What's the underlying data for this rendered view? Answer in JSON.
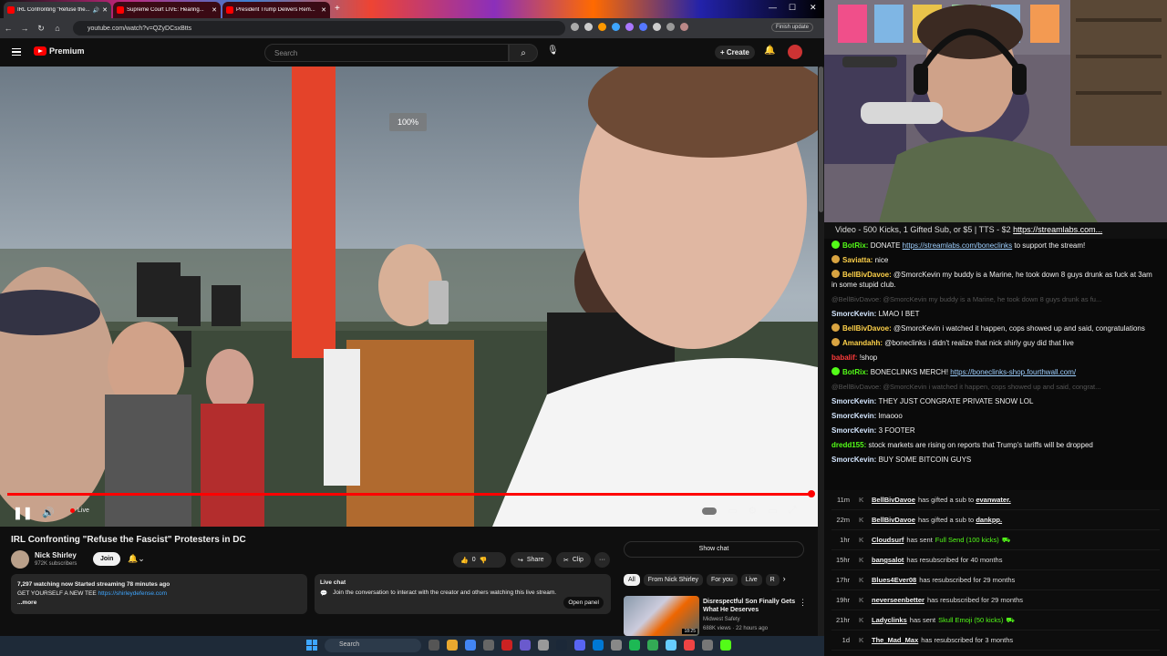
{
  "browser": {
    "tabs": [
      {
        "title": "IRL Confronting \"Refuse the...",
        "active": true
      },
      {
        "title": "Supreme Court LIVE: Hearing...",
        "active": false
      },
      {
        "title": "President Trump Delivers Rem...",
        "active": false
      }
    ],
    "new_tab": "+",
    "url": "youtube.com/watch?v=QZyDCsxBtts",
    "finish_update": "Finish update"
  },
  "youtube": {
    "logo_label": "Premium",
    "search_placeholder": "Search",
    "create_label": "Create",
    "player": {
      "zoom_label": "100%",
      "live_label": "Live",
      "progress": 1.0
    },
    "video": {
      "title": "IRL Confronting \"Refuse the Fascist\" Protesters in DC",
      "channel": "Nick Shirley",
      "subscribers": "972K subscribers",
      "join_label": "Join",
      "likes": "0",
      "share_label": "Share",
      "clip_label": "Clip",
      "more_label": "···"
    },
    "description": {
      "stats": "7,297 watching now  Started streaming 78 minutes ago",
      "line": "GET YOURSELF A NEW TEE",
      "link": "https://shirleydefense.com",
      "more": "...more"
    },
    "live_chat": {
      "heading": "Live chat",
      "body": "Join the conversation to interact with the creator and others watching this live stream.",
      "open_panel": "Open panel"
    },
    "show_chat": "Show chat",
    "chips": [
      "All",
      "From Nick Shirley",
      "For you",
      "Live",
      "R"
    ],
    "recommendation": {
      "title": "Disrespectful Son Finally Gets What He Deserves",
      "channel": "Midwest Safety",
      "meta": "688K views · 22 hours ago",
      "duration": "18:25"
    }
  },
  "stream_overlay": {
    "ticker_text": "Video - 500 Kicks, 1 Gifted Sub, or $5 | TTS - $2",
    "ticker_link": "https://streamlabs.com...",
    "chat": [
      {
        "user": "BotRix:",
        "text": "DONATE",
        "link": "https://streamlabs.com/boneclinks",
        "tail": "to support the stream!",
        "color": "#53fc18",
        "badge": "#53fc18"
      },
      {
        "user": "Saviatta:",
        "text": "nice",
        "color": "#ffd24a",
        "badge": "#d9a441"
      },
      {
        "user": "BellBivDavoe:",
        "text": "@SmorcKevin my buddy is a Marine, he took down 8 guys drunk as fuck at 3am in some stupid club.",
        "color": "#ffd24a",
        "badge": "#d9a441"
      },
      {
        "ghost": true,
        "text": "@BellBivDavoe: @SmorcKevin my buddy is a Marine, he took down 8 guys drunk as fu..."
      },
      {
        "user": "SmorcKevin:",
        "text": "LMAO I BET",
        "color": "#d4e6ff"
      },
      {
        "user": "BellBivDavoe:",
        "text": "@SmorcKevin i watched it happen, cops showed up and said, congratulations",
        "color": "#ffd24a",
        "badge": "#d9a441"
      },
      {
        "user": "Amandahh:",
        "text": "@boneclinks i didn't realize that nick shirly guy did that live",
        "color": "#ffd24a",
        "badge": "#d9a441"
      },
      {
        "user": "babalif:",
        "text": "!shop",
        "color": "#ff3b3b"
      },
      {
        "user": "BotRix:",
        "text": "BONECLINKS MERCH!",
        "link": "https://boneclinks-shop.fourthwall.com/",
        "color": "#53fc18",
        "badge": "#53fc18"
      },
      {
        "ghost": true,
        "text": "@BellBivDavoe: @SmorcKevin i watched it happen, cops showed up and said, congrat..."
      },
      {
        "user": "SmorcKevin:",
        "text": "THEY JUST CONGRATE PRIVATE SNOW LOL",
        "color": "#d4e6ff"
      },
      {
        "user": "SmorcKevin:",
        "text": "lmaooo",
        "color": "#d4e6ff"
      },
      {
        "user": "SmorcKevin:",
        "text": "3 FOOTER",
        "color": "#d4e6ff"
      },
      {
        "user": "dredd155:",
        "text": "stock markets are rising on reports that Trump's tariffs will be dropped",
        "color": "#53fc18"
      },
      {
        "user": "SmorcKevin:",
        "text": "BUY SOME BITCOIN GUYS",
        "color": "#d4e6ff"
      }
    ],
    "events": [
      {
        "time": "11m",
        "user": "BellBivDavoe",
        "text": "has gifted a sub to",
        "target": "evanwater."
      },
      {
        "time": "22m",
        "user": "BellBivDavoe",
        "text": "has gifted a sub to",
        "target": "dankpp."
      },
      {
        "time": "1hr",
        "user": "Cloudsurf",
        "text": "has sent",
        "highlight": "Full Send (100 kicks)"
      },
      {
        "time": "15hr",
        "user": "bangsalot",
        "text": "has resubscribed for 40 months"
      },
      {
        "time": "17hr",
        "user": "Blues4Ever08",
        "text": "has resubscribed for 29 months"
      },
      {
        "time": "19hr",
        "user": "neverseenbetter",
        "text": "has resubscribed for 29 months"
      },
      {
        "time": "21hr",
        "user": "Ladyclinks",
        "text": "has sent",
        "highlight": "Skull Emoji (50 kicks)"
      },
      {
        "time": "1d",
        "user": "The_Mad_Max",
        "text": "has resubscribed for 3 months"
      }
    ]
  },
  "taskbar": {
    "search_placeholder": "Search"
  }
}
